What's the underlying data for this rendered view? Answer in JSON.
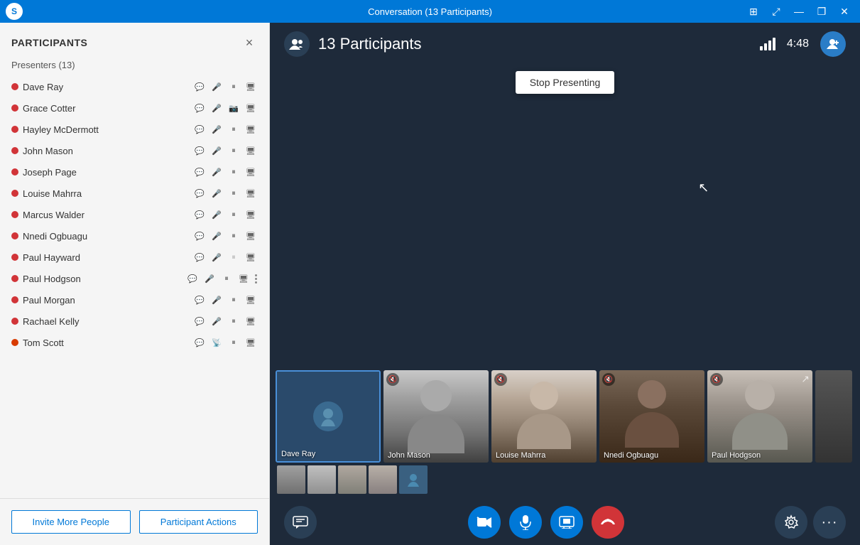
{
  "titlebar": {
    "title": "Conversation (13 Participants)",
    "logo_text": "S",
    "controls": {
      "snap": "⊞",
      "maximize": "⤢",
      "minimize": "—",
      "restore": "❐",
      "close": "✕"
    }
  },
  "sidebar": {
    "title": "PARTICIPANTS",
    "close_label": "×",
    "presenters_label": "Presenters (13)",
    "participants": [
      {
        "name": "Dave Ray",
        "status": "red"
      },
      {
        "name": "Grace Cotter",
        "status": "red"
      },
      {
        "name": "Hayley McDermott",
        "status": "red"
      },
      {
        "name": "John Mason",
        "status": "red"
      },
      {
        "name": "Joseph Page",
        "status": "red"
      },
      {
        "name": "Louise Mahrra",
        "status": "red"
      },
      {
        "name": "Marcus Walder",
        "status": "red"
      },
      {
        "name": "Nnedi Ogbuagu",
        "status": "red"
      },
      {
        "name": "Paul Hayward",
        "status": "red"
      },
      {
        "name": "Paul Hodgson",
        "status": "red"
      },
      {
        "name": "Paul Morgan",
        "status": "red"
      },
      {
        "name": "Rachael Kelly",
        "status": "red"
      },
      {
        "name": "Tom Scott",
        "status": "orange"
      }
    ],
    "footer": {
      "invite_label": "Invite More People",
      "actions_label": "Participant Actions"
    }
  },
  "video_header": {
    "participants_count": "13 Participants",
    "timer": "4:48"
  },
  "stop_presenting": {
    "label": "Stop Presenting"
  },
  "video_tiles": [
    {
      "name": "Dave Ray",
      "type": "avatar"
    },
    {
      "name": "John Mason",
      "type": "photo",
      "class": "tile-john",
      "muted": true
    },
    {
      "name": "Louise Mahrra",
      "type": "photo",
      "class": "tile-louise",
      "muted": true
    },
    {
      "name": "Nnedi Ogbuagu",
      "type": "photo",
      "class": "tile-nnedi",
      "muted": true
    },
    {
      "name": "Paul Hodgson",
      "type": "photo",
      "class": "tile-paul",
      "muted": true
    }
  ],
  "toolbar": {
    "chat_icon": "💬",
    "video_muted_icon": "🎥",
    "mic_icon": "🎤",
    "screen_icon": "🖥",
    "hangup_icon": "📞",
    "settings_icon": "⚙",
    "more_icon": "···"
  }
}
